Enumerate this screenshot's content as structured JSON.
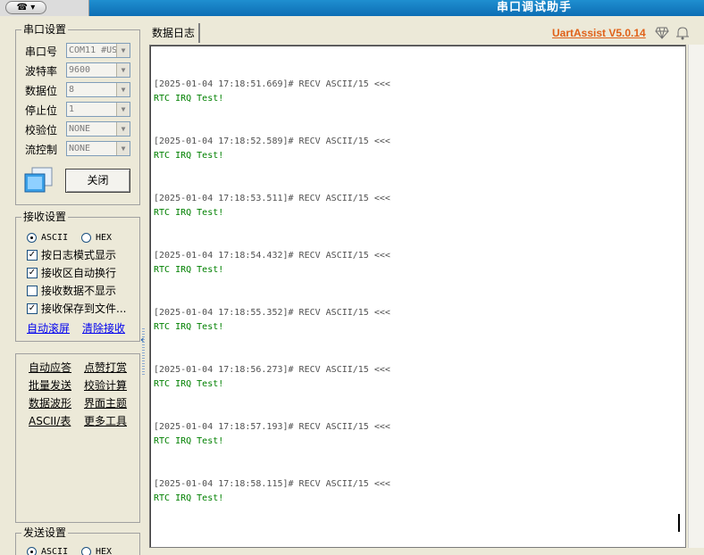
{
  "titlebar": {
    "title": "串口调试助手",
    "menu_glyph": "☎ ▾"
  },
  "serial": {
    "group_title": "串口设置",
    "port_label": "串口号",
    "port_value": "COM11 #US",
    "baud_label": "波特率",
    "baud_value": "9600",
    "data_label": "数据位",
    "data_value": "8",
    "stop_label": "停止位",
    "stop_value": "1",
    "parity_label": "校验位",
    "parity_value": "NONE",
    "flow_label": "流控制",
    "flow_value": "NONE",
    "close_button": "关闭"
  },
  "receive": {
    "group_title": "接收设置",
    "ascii": "ASCII",
    "hex": "HEX",
    "opt_log_mode": "按日志模式显示",
    "opt_autowrap": "接收区自动换行",
    "opt_hide": "接收数据不显示",
    "opt_save": "接收保存到文件...",
    "link_autoscroll": "自动滚屏",
    "link_clear": "清除接收"
  },
  "tools": {
    "auto_reply": "自动应答",
    "tip": "点赞打赏",
    "batch_send": "批量发送",
    "checksum": "校验计算",
    "waveform": "数据波形",
    "theme": "界面主题",
    "ascii_table": "ASCII/表",
    "more": "更多工具"
  },
  "send": {
    "group_title": "发送设置",
    "ascii": "ASCII",
    "hex": "HEX"
  },
  "main": {
    "tab_label": "数据日志",
    "brand": "UartAssist V5.0.14",
    "log": [
      {
        "header": "[2025-01-04 17:18:51.669]# RECV ASCII/15 <<<",
        "message": "RTC IRQ Test!"
      },
      {
        "header": "[2025-01-04 17:18:52.589]# RECV ASCII/15 <<<",
        "message": "RTC IRQ Test!"
      },
      {
        "header": "[2025-01-04 17:18:53.511]# RECV ASCII/15 <<<",
        "message": "RTC IRQ Test!"
      },
      {
        "header": "[2025-01-04 17:18:54.432]# RECV ASCII/15 <<<",
        "message": "RTC IRQ Test!"
      },
      {
        "header": "[2025-01-04 17:18:55.352]# RECV ASCII/15 <<<",
        "message": "RTC IRQ Test!"
      },
      {
        "header": "[2025-01-04 17:18:56.273]# RECV ASCII/15 <<<",
        "message": "RTC IRQ Test!"
      },
      {
        "header": "[2025-01-04 17:18:57.193]# RECV ASCII/15 <<<",
        "message": "RTC IRQ Test!"
      },
      {
        "header": "[2025-01-04 17:18:58.115]# RECV ASCII/15 <<<",
        "message": "RTC IRQ Test!"
      }
    ]
  },
  "colors": {
    "titlebar": "#0c6db4",
    "brand": "#e0621a",
    "log_message": "#008000"
  }
}
